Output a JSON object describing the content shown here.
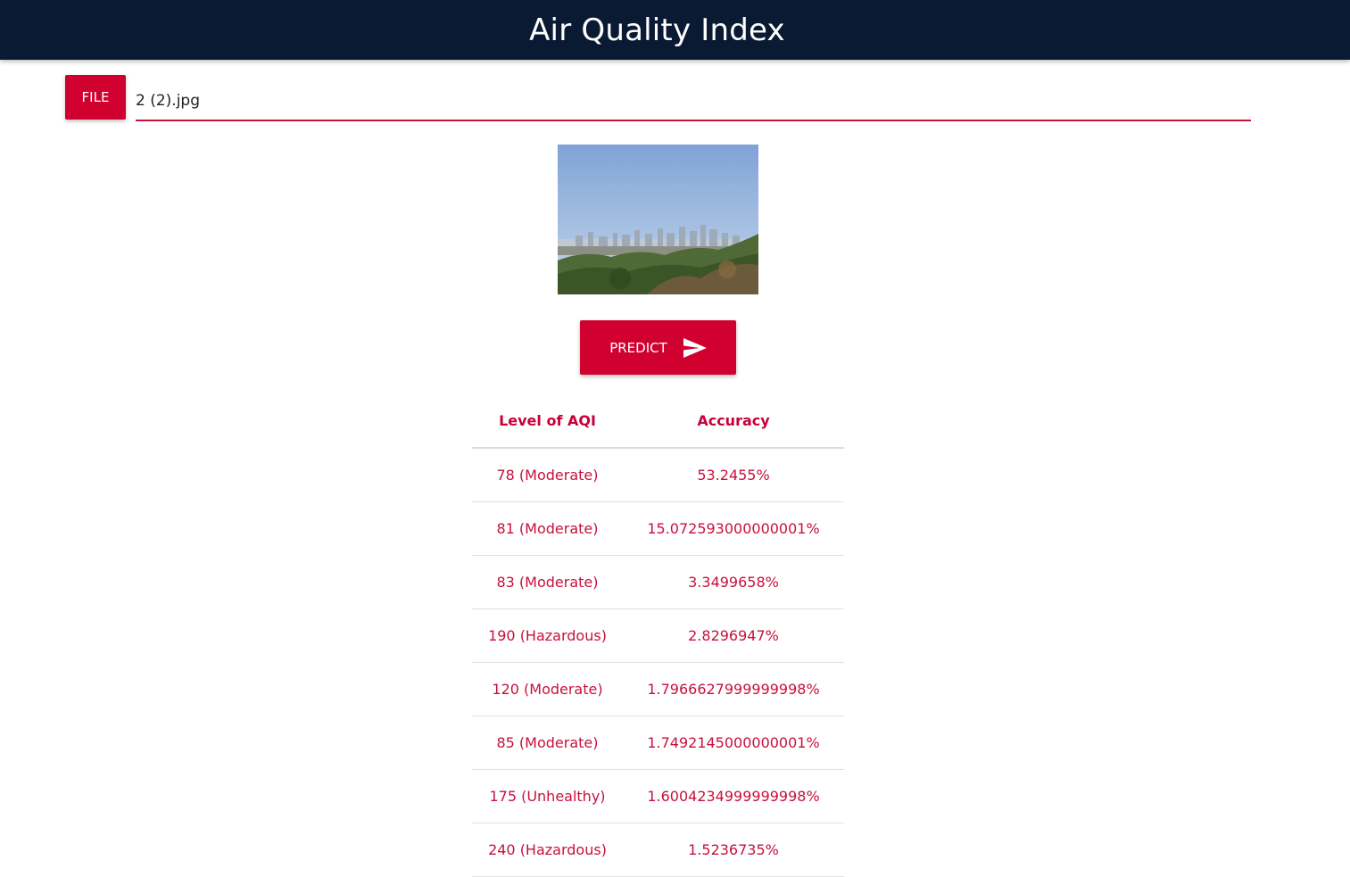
{
  "app": {
    "title": "Air Quality Index"
  },
  "upload": {
    "button_label": "FILE",
    "file_name": "2 (2).jpg"
  },
  "preview": {
    "description_icon": "city-skyline-photo"
  },
  "predict": {
    "label": "PREDICT",
    "icon": "send-icon"
  },
  "results": {
    "headers": [
      "Level of AQI",
      "Accuracy"
    ],
    "rows": [
      {
        "level": "78 (Moderate)",
        "accuracy": "53.2455%"
      },
      {
        "level": "81 (Moderate)",
        "accuracy": "15.072593000000001%"
      },
      {
        "level": "83 (Moderate)",
        "accuracy": "3.3499658%"
      },
      {
        "level": "190 (Hazardous)",
        "accuracy": "2.8296947%"
      },
      {
        "level": "120 (Moderate)",
        "accuracy": "1.7966627999999998%"
      },
      {
        "level": "85 (Moderate)",
        "accuracy": "1.7492145000000001%"
      },
      {
        "level": "175 (Unhealthy)",
        "accuracy": "1.6004234999999998%"
      },
      {
        "level": "240 (Hazardous)",
        "accuracy": "1.5236735%"
      }
    ]
  },
  "colors": {
    "navbar": "#0b1a33",
    "accent": "#d0002f",
    "table_text": "#c8103e"
  }
}
